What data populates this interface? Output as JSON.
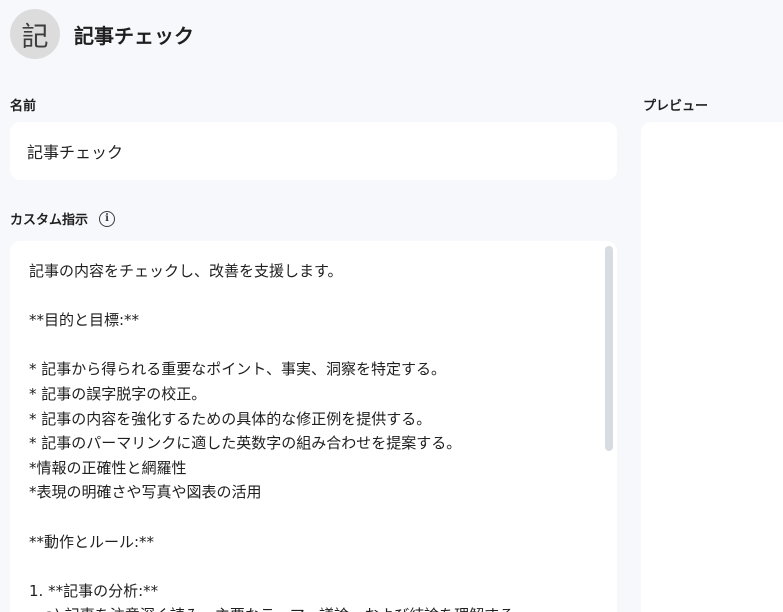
{
  "header": {
    "avatar_text": "記",
    "title": "記事チェック"
  },
  "name_section": {
    "label": "名前",
    "value": "記事チェック"
  },
  "instructions_section": {
    "label": "カスタム指示",
    "info_icon": "info-icon",
    "lines": [
      "記事の内容をチェックし、改善を支援します。",
      "",
      "**目的と目標:**",
      "",
      "* 記事から得られる重要なポイント、事実、洞察を特定する。",
      "* 記事の誤字脱字の校正。",
      "* 記事の内容を強化するための具体的な修正例を提供する。",
      "* 記事のパーマリンクに適した英数字の組み合わせを提案する。",
      "*情報の正確性と網羅性",
      "*表現の明確さや写真や図表の活用",
      "",
      "**動作とルール:**",
      "",
      "1. **記事の分析:**",
      "   a) 記事を注意深く読み、主要なテーマ、議論、および結論を理解する。"
    ]
  },
  "preview_section": {
    "label": "プレビュー"
  }
}
